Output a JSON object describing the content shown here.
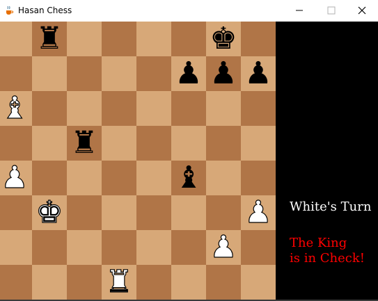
{
  "window": {
    "title": "Hasan Chess",
    "icon": "java-cup-icon",
    "controls": [
      "minimize",
      "maximize",
      "close"
    ]
  },
  "board": {
    "light_color": "#d7a878",
    "dark_color": "#b07547",
    "files": 8,
    "ranks": 8,
    "pieces": [
      {
        "square": "b8",
        "color": "black",
        "type": "rook",
        "glyph": "♜"
      },
      {
        "square": "g8",
        "color": "black",
        "type": "king",
        "glyph": "♚"
      },
      {
        "square": "f7",
        "color": "black",
        "type": "pawn",
        "glyph": "♟"
      },
      {
        "square": "g7",
        "color": "black",
        "type": "pawn",
        "glyph": "♟"
      },
      {
        "square": "h7",
        "color": "black",
        "type": "pawn",
        "glyph": "♟"
      },
      {
        "square": "a6",
        "color": "white",
        "type": "bishop",
        "glyph": "♝"
      },
      {
        "square": "c5",
        "color": "black",
        "type": "rook",
        "glyph": "♜"
      },
      {
        "square": "a4",
        "color": "white",
        "type": "pawn",
        "glyph": "♟"
      },
      {
        "square": "f4",
        "color": "black",
        "type": "bishop",
        "glyph": "♝"
      },
      {
        "square": "b3",
        "color": "white",
        "type": "king",
        "glyph": "♚"
      },
      {
        "square": "h3",
        "color": "white",
        "type": "pawn",
        "glyph": "♟"
      },
      {
        "square": "g2",
        "color": "white",
        "type": "pawn",
        "glyph": "♟"
      },
      {
        "square": "d1",
        "color": "white",
        "type": "rook",
        "glyph": "♜"
      }
    ]
  },
  "status": {
    "turn": "White's Turn",
    "check_line1": "The King",
    "check_line2": "is in Check!",
    "turn_color": "#ffffff",
    "check_color": "#ff0000",
    "panel_color": "#000000"
  }
}
